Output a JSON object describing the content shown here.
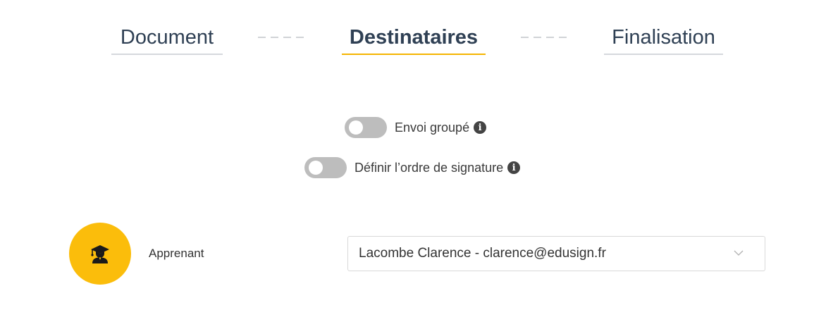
{
  "stepper": {
    "steps": [
      {
        "label": "Document",
        "active": false
      },
      {
        "label": "Destinataires",
        "active": true
      },
      {
        "label": "Finalisation",
        "active": false
      }
    ]
  },
  "options": {
    "grouped_send": {
      "label": "Envoi groupé",
      "enabled": false
    },
    "signature_order": {
      "label": "Définir l’ordre de signature",
      "enabled": false
    }
  },
  "recipient": {
    "role": "Apprenant",
    "selected": "Lacombe Clarence - clarence@edusign.fr",
    "avatar_icon": "graduate-icon"
  },
  "colors": {
    "accent": "#f5b400",
    "avatar_bg": "#fbbd0b",
    "toggle_off": "#bdbdbd",
    "title": "#2f4054"
  }
}
